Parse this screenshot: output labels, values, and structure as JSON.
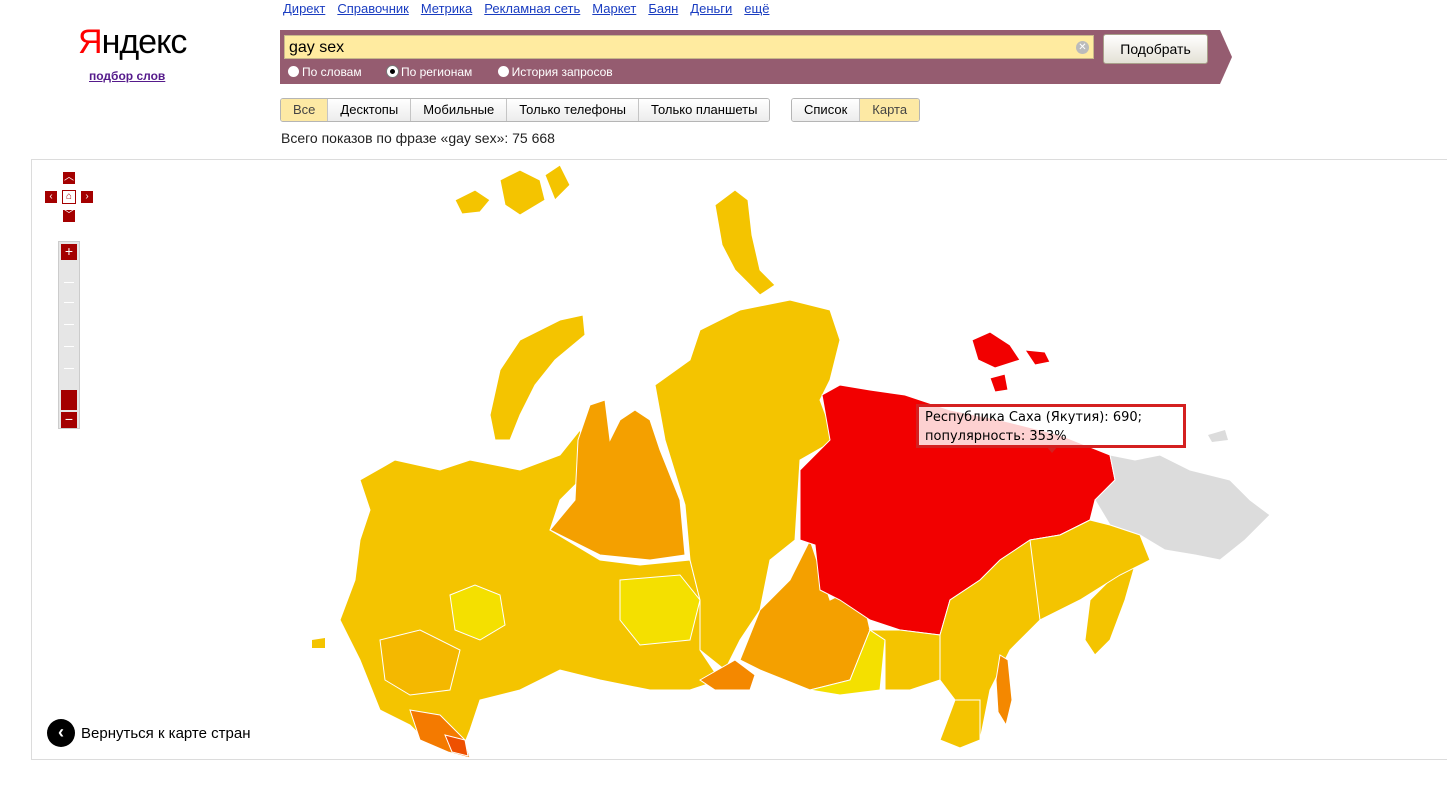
{
  "logo": {
    "first_letter": "Я",
    "rest": "ндекс",
    "sublink": "подбор слов"
  },
  "topnav": [
    "Директ",
    "Справочник",
    "Метрика",
    "Рекламная сеть",
    "Маркет",
    "Баян",
    "Деньги",
    "ещё"
  ],
  "search": {
    "value": "gay sex",
    "submit": "Подобрать",
    "clear_icon": "clear-icon"
  },
  "modes": [
    {
      "label": "По словам",
      "selected": false
    },
    {
      "label": "По регионам",
      "selected": true
    },
    {
      "label": "История запросов",
      "selected": false
    }
  ],
  "device_filters": [
    {
      "label": "Все",
      "selected": true
    },
    {
      "label": "Десктопы",
      "selected": false
    },
    {
      "label": "Мобильные",
      "selected": false
    },
    {
      "label": "Только телефоны",
      "selected": false
    },
    {
      "label": "Только планшеты",
      "selected": false
    }
  ],
  "view_toggle": [
    {
      "label": "Список",
      "selected": false
    },
    {
      "label": "Карта",
      "selected": true
    }
  ],
  "total_text": "Всего показов по фразе «gay sex»: 75 668",
  "map": {
    "tooltip_line1": "Республика Саха (Якутия): 690;",
    "tooltip_line2": "популярность: 353%",
    "back_label": "Вернуться к карте стран",
    "colors": {
      "hot": "#f20000",
      "high": "#f4a000",
      "mid": "#f4c400",
      "low": "#f4e000",
      "none": "#dcdcdc",
      "control": "#a40000"
    }
  }
}
